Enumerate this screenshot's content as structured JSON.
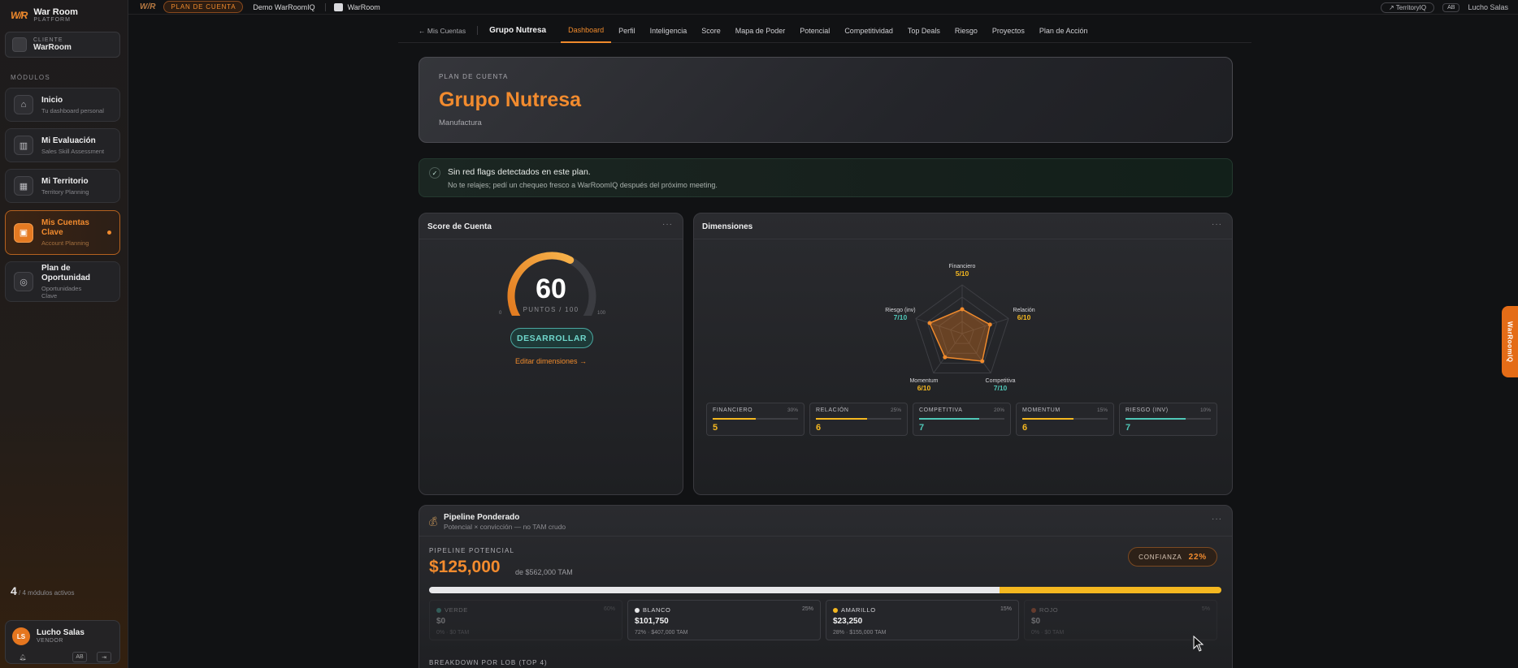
{
  "sidebar": {
    "brand": {
      "mark": "W/R",
      "name": "War Room",
      "sub": "PLATFORM"
    },
    "client": {
      "label": "CLIENTE",
      "name": "WarRoom"
    },
    "modules_label": "MÓDULOS",
    "items": [
      {
        "title": "Inicio",
        "sub": "Tu dashboard personal",
        "icon": "home-icon"
      },
      {
        "title": "Mi Evaluación",
        "sub": "Sales Skill Assessment",
        "icon": "chart-icon"
      },
      {
        "title": "Mi Territorio",
        "sub": "Territory Planning",
        "icon": "map-icon"
      },
      {
        "title": "Mis Cuentas Clave",
        "sub": "Account Planning",
        "icon": "briefcase-icon",
        "active": true
      },
      {
        "title": "Plan de Oportunidad",
        "sub": "Oportunidades Clave",
        "icon": "target-icon"
      }
    ],
    "module_count": "4",
    "module_count_text": "/ 4 módulos activos",
    "user": {
      "initials": "LS",
      "name": "Lucho Salas",
      "role": "VENDOR",
      "badge": "AB"
    }
  },
  "topbar": {
    "logo": "W/R",
    "pill": "PLAN DE CUENTA",
    "demo": "Demo WarRoomIQ",
    "workspace": "WarRoom",
    "territory_btn": "↗ TerritoryIQ",
    "user_badge": "AB",
    "user_name": "Lucho Salas"
  },
  "account_nav": {
    "back": "← Mis Cuentas",
    "title": "Grupo Nutresa",
    "tabs": [
      "Dashboard",
      "Perfil",
      "Inteligencia",
      "Score",
      "Mapa de Poder",
      "Potencial",
      "Competitividad",
      "Top Deals",
      "Riesgo",
      "Proyectos",
      "Plan de Acción"
    ],
    "active_tab": "Dashboard"
  },
  "hero": {
    "label": "PLAN DE CUENTA",
    "title": "Grupo Nutresa",
    "industry": "Manufactura"
  },
  "flag": {
    "title": "Sin red flags detectados en este plan.",
    "sub": "No te relajes; pedí un chequeo fresco a WarRoomIQ después del próximo meeting."
  },
  "score": {
    "title": "Score de Cuenta",
    "menu": "···",
    "value": 60,
    "max": 100,
    "units": "PUNTOS / 100",
    "min_label": "0",
    "max_label": "100",
    "status": "DESARROLLAR",
    "edit_link": "Editar dimensiones →"
  },
  "dimensions": {
    "title": "Dimensiones",
    "menu": "···",
    "axes": [
      {
        "name": "Financiero",
        "value": 5,
        "display": "5/10",
        "color": "#f5b820"
      },
      {
        "name": "Relación",
        "value": 6,
        "display": "6/10",
        "color": "#f5b820"
      },
      {
        "name": "Competitiva",
        "value": 7,
        "display": "7/10",
        "color": "#4fc8b8"
      },
      {
        "name": "Momentum",
        "value": 6,
        "display": "6/10",
        "color": "#f5b820"
      },
      {
        "name": "Riesgo (inv)",
        "value": 7,
        "display": "7/10",
        "color": "#4fc8b8"
      }
    ],
    "boxes": [
      {
        "name": "FINANCIERO",
        "weight": "30%",
        "value": "5",
        "fill": 0.5,
        "color": "#f5b820"
      },
      {
        "name": "RELACIÓN",
        "weight": "25%",
        "value": "6",
        "fill": 0.6,
        "color": "#f5b820"
      },
      {
        "name": "COMPETITIVA",
        "weight": "20%",
        "value": "7",
        "fill": 0.7,
        "color": "#4fc8b8"
      },
      {
        "name": "MOMENTUM",
        "weight": "15%",
        "value": "6",
        "fill": 0.6,
        "color": "#f5b820"
      },
      {
        "name": "RIESGO (INV)",
        "weight": "10%",
        "value": "7",
        "fill": 0.7,
        "color": "#4fc8b8"
      }
    ]
  },
  "pipeline": {
    "icon": "money-bag-icon",
    "title": "Pipeline Ponderado",
    "sub": "Potencial × convicción — no TAM crudo",
    "menu": "···",
    "label": "PIPELINE POTENCIAL",
    "value": "$125,000",
    "tam": "de $562,000 TAM",
    "confidence_label": "CONFIANZA",
    "confidence_value": "22%",
    "bar": [
      {
        "color": "#e8e8ea",
        "share": 0.72
      },
      {
        "color": "#f5b820",
        "share": 0.28
      }
    ],
    "segments": [
      {
        "name": "VERDE",
        "pct": "60%",
        "value": "$0",
        "sub": "0% · $0 TAM",
        "color": "#4fc8b8",
        "dim": true
      },
      {
        "name": "BLANCO",
        "pct": "25%",
        "value": "$101,750",
        "sub": "72% · $407,000 TAM",
        "color": "#e8e8ea",
        "dim": false
      },
      {
        "name": "AMARILLO",
        "pct": "15%",
        "value": "$23,250",
        "sub": "28% · $155,000 TAM",
        "color": "#f5b820",
        "dim": false
      },
      {
        "name": "ROJO",
        "pct": "5%",
        "value": "$0",
        "sub": "0% · $0 TAM",
        "color": "#e0673a",
        "dim": true
      }
    ],
    "lob_label": "BREAKDOWN POR LOB (TOP 4)"
  },
  "side_tab": "WarRoomIQ",
  "colors": {
    "accent": "#f28b2e",
    "teal": "#4fc8b8",
    "yellow": "#f5b820"
  }
}
